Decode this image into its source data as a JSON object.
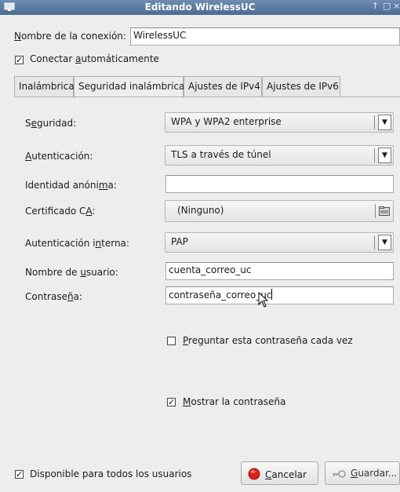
{
  "window": {
    "title": "Editando WirelessUC",
    "controls": [
      "↑",
      "□",
      "×"
    ]
  },
  "connection": {
    "name_label": "Nombre de la conexión:",
    "name_value": "WirelessUC",
    "auto_connect_label": "Conectar automáticamente",
    "auto_connect_checked": true
  },
  "tabs": [
    {
      "label": "Inalámbrica"
    },
    {
      "label": "Seguridad inalámbrica",
      "active": true
    },
    {
      "label": "Ajustes de IPv4"
    },
    {
      "label": "Ajustes de IPv6"
    }
  ],
  "security": {
    "security_label": "Seguridad:",
    "security_value": "WPA y WPA2 enterprise",
    "auth_label": "Autenticación:",
    "auth_value": "TLS a través de túnel",
    "anon_identity_label": "Identidad anónima:",
    "anon_identity_value": "",
    "ca_cert_label": "Certificado CA:",
    "ca_cert_value": "(Ninguno)",
    "inner_auth_label": "Autenticación interna:",
    "inner_auth_value": "PAP",
    "username_label": "Nombre de usuario:",
    "username_value": "cuenta_correo_uc",
    "password_label": "Contraseña:",
    "password_value": "contraseña_correo_uc",
    "ask_password_label": "Preguntar esta contraseña cada vez",
    "ask_password_checked": false,
    "show_password_label": "Mostrar la contraseña",
    "show_password_checked": true
  },
  "footer": {
    "all_users_label": "Disponible para todos los usuarios",
    "all_users_checked": true,
    "cancel_label": "Cancelar",
    "save_label": "Guardar..."
  },
  "colors": {
    "titlebar": "#4a6b93",
    "cancel_icon": "#e0201a"
  },
  "icons": [
    "window-icon",
    "combo-arrow-icon",
    "file-chooser-icon",
    "mouse-cursor-icon",
    "cancel-icon",
    "key-icon"
  ]
}
